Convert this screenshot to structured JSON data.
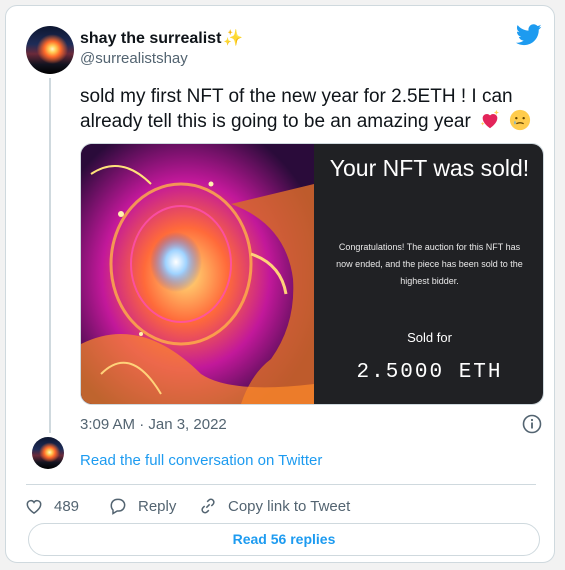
{
  "author": {
    "name": "shay the surrealist",
    "name_emoji": "✨",
    "handle": "@surrealistshay"
  },
  "tweet": {
    "text": "sold my first NFT of the new year for 2.5ETH ! I can already tell this is going to be an amazing year",
    "emojis": [
      "sparkling-heart",
      "face-holding-back-tears"
    ],
    "timestamp": "3:09 AM · Jan 3, 2022"
  },
  "media": {
    "title": "Your NFT was sold!",
    "body": "Congratulations! The auction for this NFT has now ended, and the piece has been sold to the highest bidder.",
    "sold_label": "Sold for",
    "sold_value": "2.5000 ETH"
  },
  "conversation_link": "Read the full conversation on Twitter",
  "actions": {
    "like_count": "489",
    "reply_label": "Reply",
    "copy_link_label": "Copy link to Tweet"
  },
  "read_replies_label": "Read 56 replies",
  "colors": {
    "accent": "#1d9bf0",
    "secondary_text": "#536471",
    "border": "#cfd9de",
    "panel_bg": "#202124"
  },
  "icons": [
    "twitter-bird-icon",
    "info-icon",
    "heart-icon",
    "reply-icon",
    "link-icon"
  ]
}
